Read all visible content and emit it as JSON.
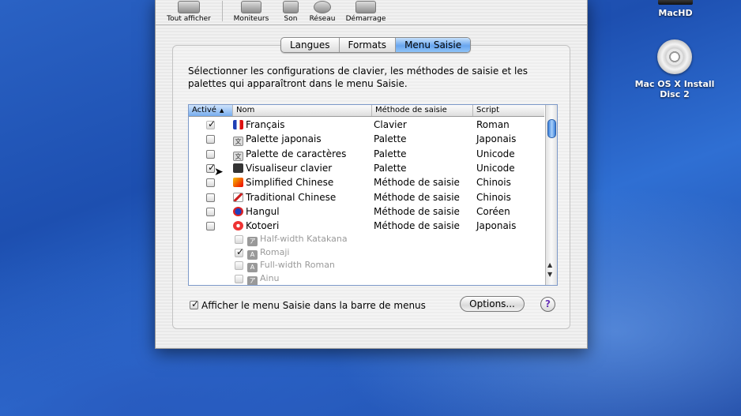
{
  "desktop": {
    "icons": [
      {
        "label": "MacHD"
      },
      {
        "label": "Mac OS X Install Disc 2"
      }
    ]
  },
  "toolbar": {
    "items": [
      {
        "label": "Tout afficher",
        "icon": "show-all-icon"
      },
      {
        "label": "Moniteurs",
        "icon": "displays-icon"
      },
      {
        "label": "Son",
        "icon": "sound-icon"
      },
      {
        "label": "Réseau",
        "icon": "network-icon"
      },
      {
        "label": "Démarrage",
        "icon": "startup-disk-icon"
      }
    ]
  },
  "tabs": [
    {
      "label": "Langues",
      "selected": false
    },
    {
      "label": "Formats",
      "selected": false
    },
    {
      "label": "Menu Saisie",
      "selected": true
    }
  ],
  "description": "Sélectionner les configurations de clavier, les méthodes de saisie et les palettes qui apparaîtront dans le menu Saisie.",
  "table": {
    "headers": {
      "enabled": "Activé",
      "sort_arrow": "▲",
      "name": "Nom",
      "method": "Méthode de saisie",
      "script": "Script"
    },
    "rows": [
      {
        "checked": true,
        "gray": true,
        "icon": "flag-icon",
        "name": "Français",
        "method": "Clavier",
        "script": "Roman"
      },
      {
        "checked": false,
        "icon": "palette-icon",
        "name": "Palette japonais",
        "method": "Palette",
        "script": "Japonais"
      },
      {
        "checked": false,
        "icon": "palette-icon",
        "name": "Palette de caractères",
        "method": "Palette",
        "script": "Unicode"
      },
      {
        "checked": true,
        "icon": "keyboard-viewer-icon",
        "name": "Visualiseur clavier",
        "method": "Palette",
        "script": "Unicode"
      },
      {
        "checked": false,
        "icon": "simplified-chinese-icon",
        "name": "Simplified Chinese",
        "method": "Méthode de saisie",
        "script": "Chinois"
      },
      {
        "checked": false,
        "icon": "traditional-chinese-icon",
        "name": "Traditional Chinese",
        "method": "Méthode de saisie",
        "script": "Chinois"
      },
      {
        "checked": false,
        "icon": "hangul-icon",
        "name": "Hangul",
        "method": "Méthode de saisie",
        "script": "Coréen"
      },
      {
        "checked": false,
        "icon": "kotoeri-icon",
        "name": "Kotoeri",
        "method": "Méthode de saisie",
        "script": "Japonais"
      }
    ],
    "subrows": [
      {
        "checked": false,
        "glyph": "ア",
        "name": "Half-width Katakana"
      },
      {
        "checked": true,
        "glyph": "A",
        "name": "Romaji"
      },
      {
        "checked": false,
        "glyph": "A",
        "name": "Full-width Roman"
      },
      {
        "checked": false,
        "glyph": "ア",
        "name": "Ainu"
      }
    ]
  },
  "show_menu_checkbox": {
    "label": "Afficher le menu Saisie dans la barre de menus",
    "checked": true
  },
  "options_button": "Options...",
  "help_button": "?",
  "colors": {
    "desktop": "#2a62c4",
    "selected_tab": "#69a6ef",
    "window": "#ececec"
  }
}
